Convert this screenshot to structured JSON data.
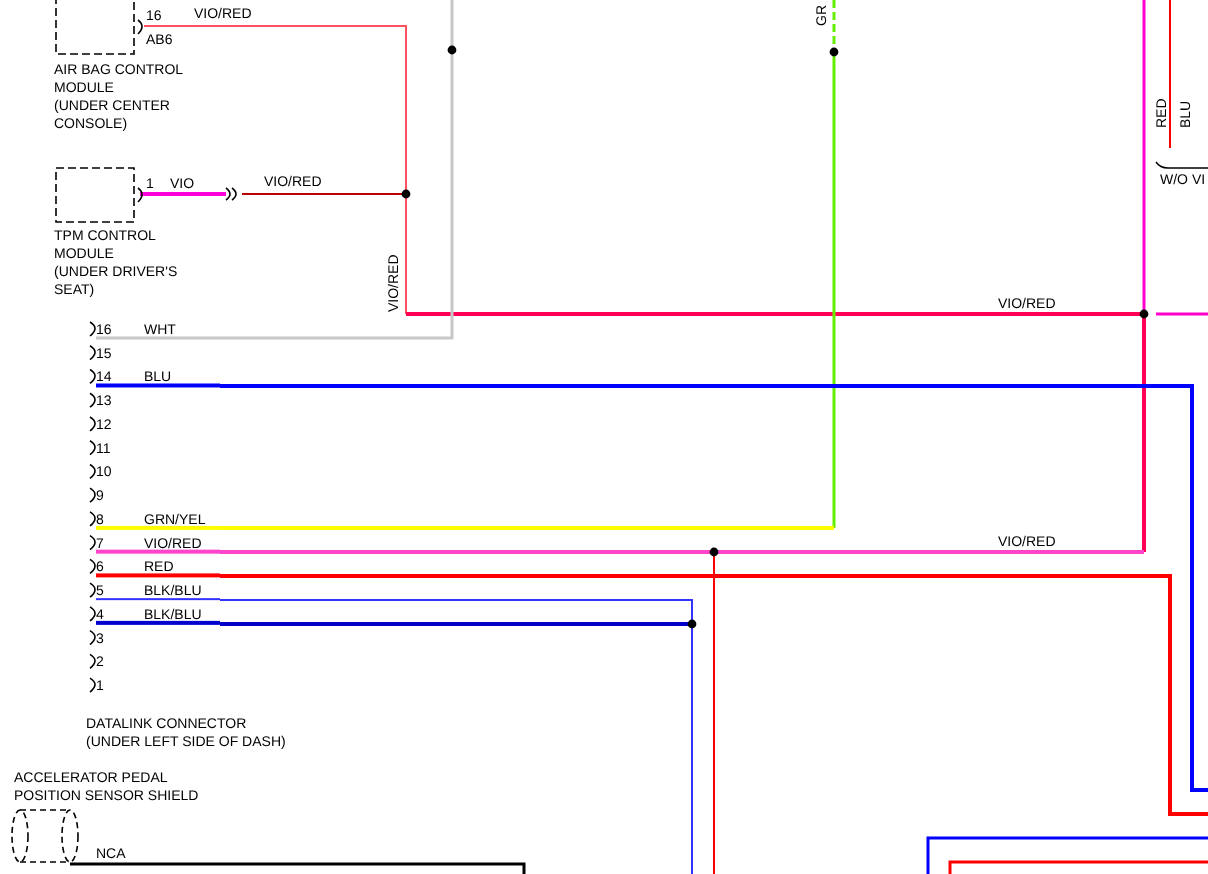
{
  "airbag_module": {
    "label": [
      "AIR BAG CONTROL",
      "MODULE",
      "(UNDER CENTER",
      "CONSOLE)"
    ],
    "pin": "16",
    "cavity": "AB6",
    "wire": "VIO/RED"
  },
  "tpm_module": {
    "label": [
      "TPM CONTROL",
      "MODULE",
      "(UNDER DRIVER'S",
      "SEAT)"
    ],
    "pin": "1",
    "wire": "VIO",
    "harness_wire": "VIO/RED"
  },
  "splice_wire_label": "VIO/RED",
  "green_wire_label": "GR",
  "bus_labels": [
    "VIO/RED",
    "VIO/RED"
  ],
  "datalink_connector": {
    "label": [
      "DATALINK CONNECTOR",
      "(UNDER LEFT SIDE OF DASH)"
    ],
    "pins": [
      {
        "number": "16",
        "wire": "WHT",
        "color": "#c8c8c8"
      },
      {
        "number": "15"
      },
      {
        "number": "14",
        "wire": "BLU",
        "color": "#0000ff"
      },
      {
        "number": "13"
      },
      {
        "number": "12"
      },
      {
        "number": "11"
      },
      {
        "number": "10"
      },
      {
        "number": "9"
      },
      {
        "number": "8",
        "wire": "GRN/YEL",
        "color": "#ffff00"
      },
      {
        "number": "7",
        "wire": "VIO/RED",
        "color": "#ff44cc"
      },
      {
        "number": "6",
        "wire": "RED",
        "color": "#ff0000"
      },
      {
        "number": "5",
        "wire": "BLK/BLU",
        "color": "#3333ff"
      },
      {
        "number": "4",
        "wire": "BLK/BLU",
        "color": "#0000cc"
      },
      {
        "number": "3"
      },
      {
        "number": "2"
      },
      {
        "number": "1"
      }
    ]
  },
  "accelerator_shield": {
    "label": [
      "ACCELERATOR PEDAL",
      "POSITION SENSOR SHIELD"
    ],
    "wire": "NCA"
  },
  "edge_labels": {
    "wires": [
      "RED",
      "BLU"
    ],
    "note": "W/O VI"
  }
}
